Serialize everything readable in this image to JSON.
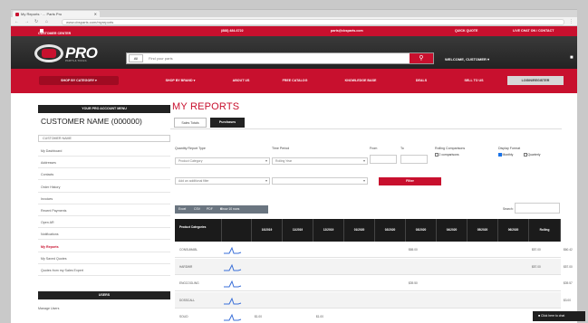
{
  "browser": {
    "tab_title": "My Reports · ... Parts Pro",
    "url": "www.cbsparts.com/myreports",
    "back": "←",
    "forward": "→",
    "reload": "↻",
    "home": "⌂",
    "menu": "⋮"
  },
  "topstrip": {
    "customer_center": "CUSTOMER CENTER",
    "phone": "(888) 484-6722",
    "email": "parts@cbsparts.com",
    "quick_quote": "QUICK QUOTE",
    "chat": "LIVE CHAT ON / CONTACT"
  },
  "header": {
    "logo_text": "PRO",
    "logo_tagline": "PARTS & TOOLS",
    "search_category": "All",
    "search_placeholder": "Find your parts",
    "search_icon": "search-icon",
    "welcome": "WELCOME, CUSTOMER",
    "cart_icon": "cart-icon"
  },
  "nav": {
    "shop": "SHOP BY CATEGORY",
    "brands": "SHOP BY BRAND",
    "about": "ABOUT US",
    "catalog": "FREE CATALOG",
    "knowledge": "KNOWLEDGE BASE",
    "deals": "DEALS",
    "sell": "SELL TO US",
    "login": "LOGIN/REGISTER"
  },
  "sidebar": {
    "header": "YOUR PRO ACCOUNT MENU",
    "customer_name": "CUSTOMER NAME (000000)",
    "customer_field": "CUSTOMER NAME",
    "items": [
      {
        "label": "My Dashboard",
        "active": false
      },
      {
        "label": "Addresses",
        "active": false
      },
      {
        "label": "Contacts",
        "active": false
      },
      {
        "label": "Order History",
        "active": false
      },
      {
        "label": "Invoices",
        "active": false
      },
      {
        "label": "Recent Payments",
        "active": false
      },
      {
        "label": "Open AR",
        "active": false
      },
      {
        "label": "Notifications",
        "active": false
      },
      {
        "label": "My Reports",
        "active": true
      },
      {
        "label": "My Saved Quotes",
        "active": false
      },
      {
        "label": "Quotes from my Sales Expert",
        "active": false
      }
    ],
    "users_header": "USERS",
    "manage_users": "Manage Users"
  },
  "main": {
    "title": "MY REPORTS",
    "tabs": [
      "Sales Totals",
      "Purchases"
    ],
    "filters": {
      "report_type_label": "Quantity Report Type",
      "report_type_value": "Product Category",
      "time_period_label": "Time Period",
      "time_period_value": "Rolling Year",
      "from_label": "From",
      "to_label": "To",
      "rolling_label": "Rolling Comparisons",
      "rolling_option": "2 comparisons",
      "display_label": "Display Format",
      "display_monthly": "Monthly",
      "display_quarterly": "Quarterly",
      "additional_value": "Add an additional filter",
      "filter_button": "Filter"
    },
    "table_buttons": [
      "Excel",
      "CSV",
      "PDF",
      "Show 10 rows"
    ],
    "search_label": "Search:",
    "columns": [
      "Product Categories",
      "",
      "10/2019",
      "11/2019",
      "12/2019",
      "01/2020",
      "02/2020",
      "03/2020",
      "04/2020",
      "05/2020",
      "06/2020",
      "Rolling"
    ],
    "rows": [
      {
        "category": "CONSUMABL",
        "cells": [
          "",
          "",
          "",
          "",
          "",
          "$65.00",
          "",
          "",
          "",
          "$57.00",
          "$60.42"
        ]
      },
      {
        "category": "HARDWR",
        "cells": [
          "",
          "",
          "",
          "",
          "",
          "",
          "",
          "",
          "",
          "$57.00",
          "$57.00"
        ]
      },
      {
        "category": "ENGCOOLING",
        "cells": [
          "",
          "",
          "",
          "",
          "",
          "$39.50",
          "",
          "",
          "",
          "",
          "$39.57"
        ]
      },
      {
        "category": "DOSSCALL",
        "cells": [
          "",
          "",
          "",
          "",
          "",
          "",
          "",
          "",
          "",
          "",
          "$3.00"
        ]
      },
      {
        "category": "SOLID",
        "cells": [
          "$1.00",
          "",
          "$1.00",
          "",
          "",
          "",
          "",
          "",
          "",
          "",
          "$1.00"
        ]
      }
    ]
  },
  "toast": "Click here to chat"
}
